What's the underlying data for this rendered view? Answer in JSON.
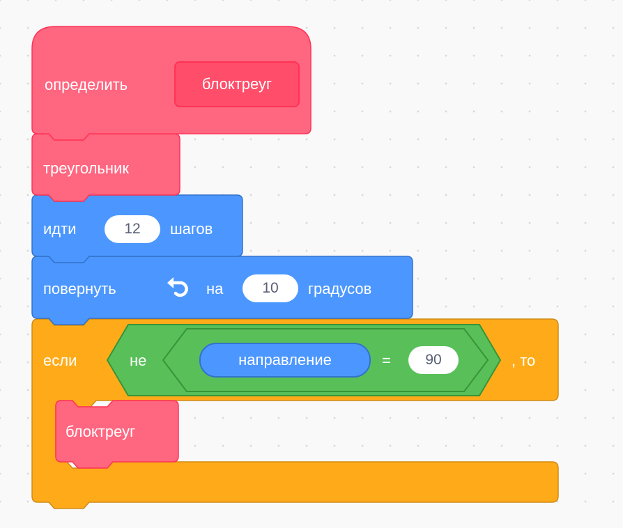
{
  "colors": {
    "custom_block": "#ff6680",
    "custom_block_border": "#ff3355",
    "motion": "#4c97ff",
    "motion_border": "#3373cc",
    "control": "#ffab19",
    "control_border": "#cf8b17",
    "operator": "#59c059",
    "operator_border": "#389438"
  },
  "blocks": {
    "define": {
      "label": "определить",
      "arg": "блоктреуг"
    },
    "triangle": {
      "label": "треугольник"
    },
    "move": {
      "label": "идти",
      "steps": "12",
      "unit": "шагов"
    },
    "turn": {
      "label": "повернуть",
      "icon": "rotate-left-icon",
      "on": "на",
      "degrees": "10",
      "unit": "градусов"
    },
    "if": {
      "label": "если",
      "not": "не",
      "reporter": "направление",
      "operator": "=",
      "value": "90",
      "then": ", то",
      "inner_call": "блоктреуг"
    }
  }
}
